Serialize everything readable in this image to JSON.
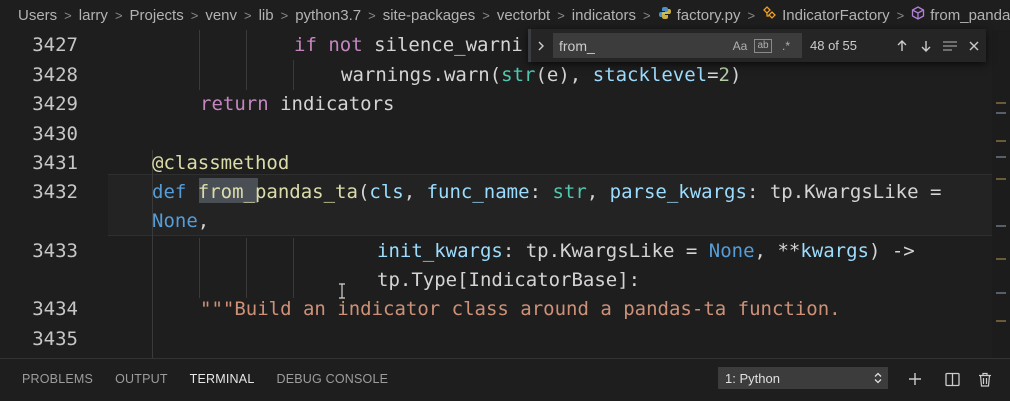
{
  "breadcrumb": {
    "items": [
      "Users",
      "larry",
      "Projects",
      "venv",
      "lib",
      "python3.7",
      "site-packages",
      "vectorbt",
      "indicators",
      "factory.py",
      "IndicatorFactory",
      "from_pandas_ta"
    ],
    "separator": ">"
  },
  "editor": {
    "line_numbers": [
      "3427",
      "3428",
      "3429",
      "3430",
      "3431",
      "3432",
      "3433",
      "3434",
      "3435"
    ],
    "lines": {
      "l3427": {
        "kw": "if not",
        "rest": " silence_warni"
      },
      "l3428": {
        "fn": "warnings.warn(",
        "fn_call": "str",
        "args": "(e), ",
        "param": "stacklevel",
        "eq": "=",
        "num": "2",
        "close": ")"
      },
      "l3429": {
        "kw": "return",
        "rest": " indicators"
      },
      "l3431": {
        "at": "@",
        "deco": "classmethod"
      },
      "l3432a": {
        "def": "def",
        "sp": " ",
        "from": "from",
        "fname": "_pandas_ta",
        "p1": "(",
        "cls": "cls",
        "c1": ", ",
        "func_name": "func_name",
        "colon1": ": ",
        "str": "str",
        "c2": ", ",
        "parse_kwargs": "parse_kwargs",
        "colon2": ": ",
        "tp1": "tp.KwargsLike",
        "eq": " ="
      },
      "l3432b": {
        "none": "None",
        "comma": ","
      },
      "l3433a": {
        "init_kwargs": "init_kwargs",
        "colon": ": ",
        "tp": "tp.KwargsLike",
        "eq": " = ",
        "none": "None",
        "c": ", ",
        "star": "**",
        "kwargs": "kwargs",
        "close": ") ->"
      },
      "l3433b": {
        "ret": "tp.Type[IndicatorBase]:"
      },
      "l3434": {
        "doc": "\"\"\"Build an indicator class around a pandas-ta function."
      }
    }
  },
  "find": {
    "value": "from_",
    "match_case": "Aa",
    "whole_word": "ab",
    "regex": ".*",
    "count": "48 of 55"
  },
  "panel": {
    "tabs": [
      "PROBLEMS",
      "OUTPUT",
      "TERMINAL",
      "DEBUG CONSOLE"
    ],
    "active_tab": "TERMINAL",
    "terminal_select": "1: Python"
  },
  "colors": {
    "background": "#1e1e1e",
    "keyword": "#c586c0",
    "function": "#dcdcaa",
    "string": "#ce9178"
  }
}
